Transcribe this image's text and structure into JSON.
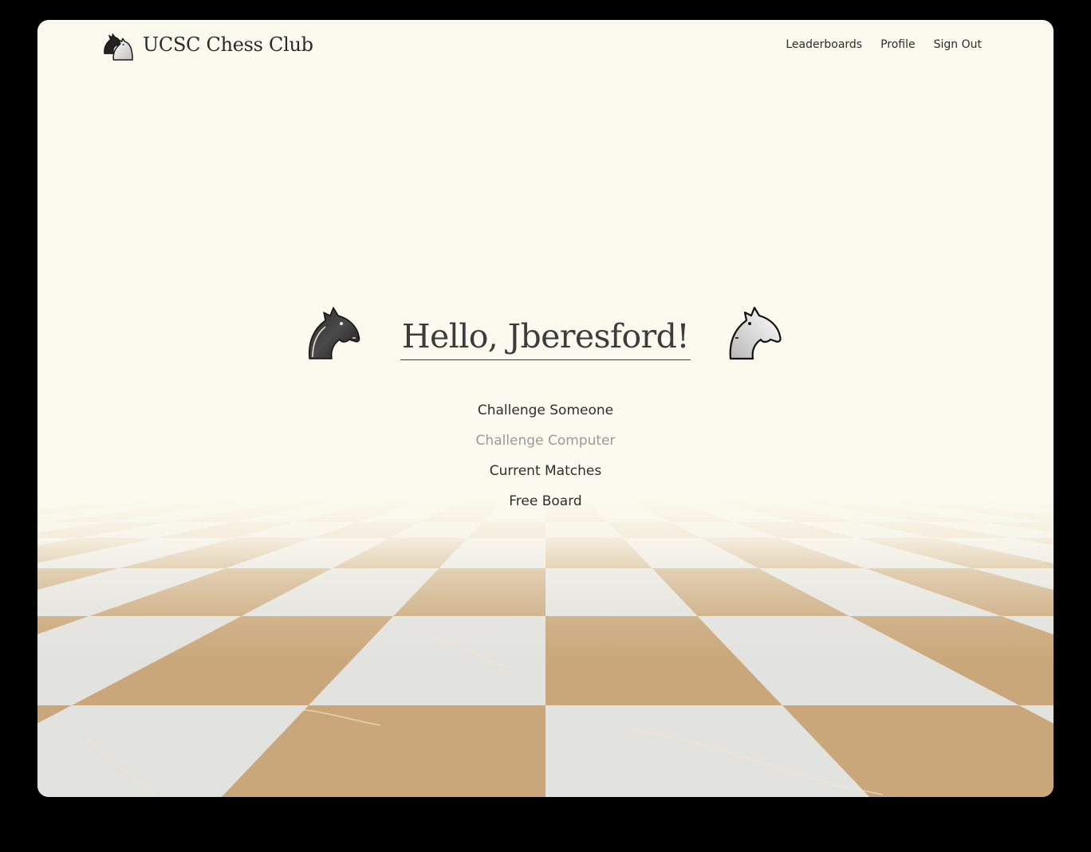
{
  "header": {
    "site_title": "UCSC Chess Club",
    "logo_icon": "knight-pair-icon"
  },
  "nav": {
    "items": [
      "Leaderboards",
      "Profile",
      "Sign Out"
    ]
  },
  "greeting": {
    "text": "Hello, Jberesford!",
    "left_icon": "black-knight-icon",
    "right_icon": "white-knight-icon"
  },
  "menu": {
    "items": [
      {
        "label": "Challenge Someone",
        "state": "active"
      },
      {
        "label": "Challenge Computer",
        "state": "disabled"
      },
      {
        "label": "Current Matches",
        "state": "active"
      },
      {
        "label": "Free Board",
        "state": "active"
      }
    ]
  },
  "colors": {
    "background": "#fcf9ee",
    "text": "#2e2e2e",
    "disabled_text": "#9a9a9a",
    "board_light": "#e2e2df",
    "board_dark": "#c9a77a"
  }
}
